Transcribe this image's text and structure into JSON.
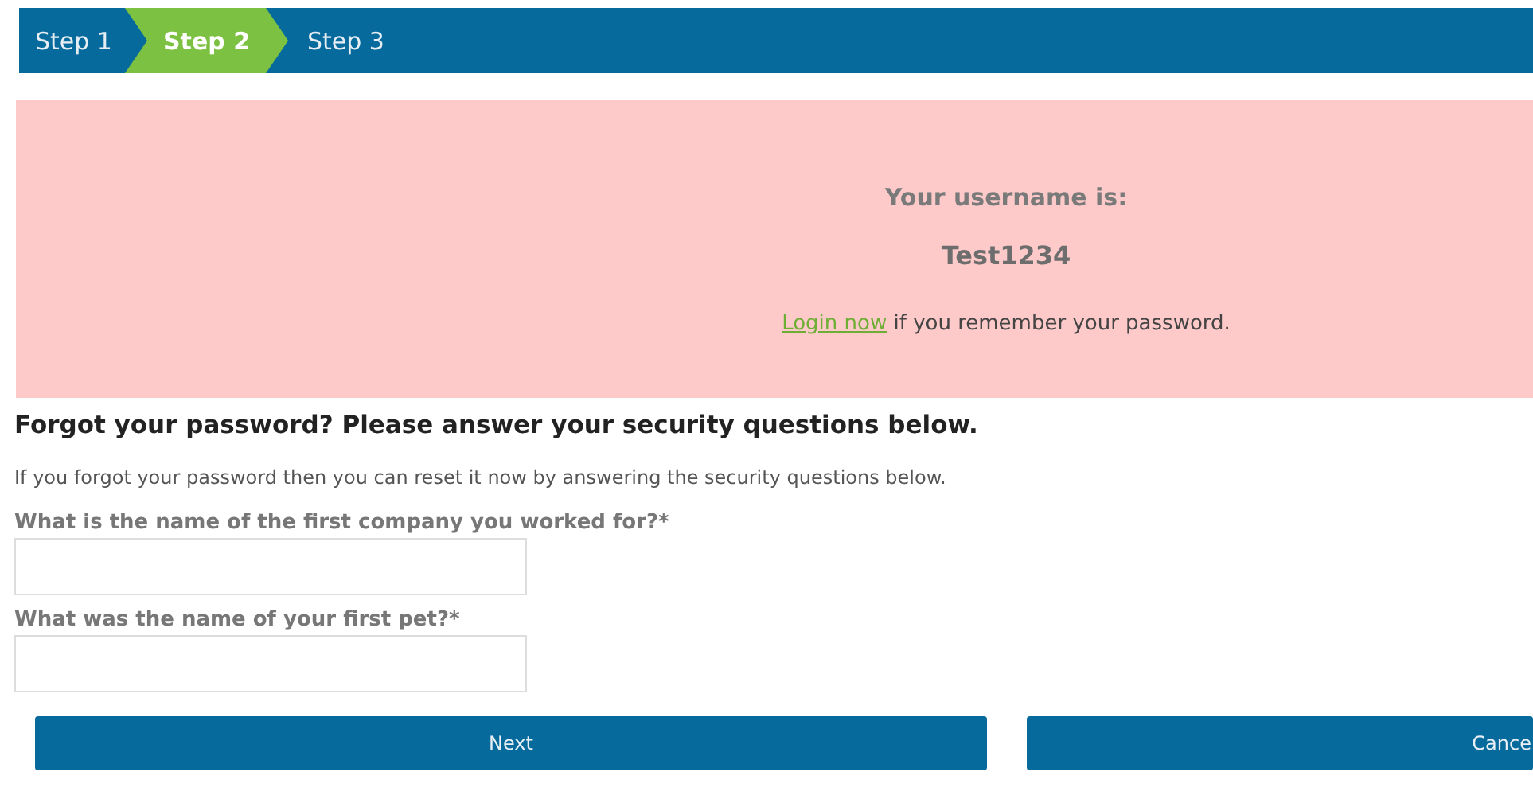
{
  "steps": [
    {
      "label": "Step 1",
      "selected": false
    },
    {
      "label": "Step 2",
      "selected": true
    },
    {
      "label": "Step 3",
      "selected": false
    }
  ],
  "notice": {
    "title": "Your username is:",
    "username": "Test1234",
    "link": "Login now",
    "after_link": " if you remember your password."
  },
  "heading": "Forgot your password? Please answer your security questions below.",
  "intro": "If you forgot your password then you can reset it now by answering the security questions below.",
  "questions": [
    {
      "label": "What is the name of the first company you worked for?*"
    },
    {
      "label": "What was the name of your first pet?*"
    }
  ],
  "buttons": [
    {
      "label": "Next"
    },
    {
      "label": "Cance"
    }
  ]
}
